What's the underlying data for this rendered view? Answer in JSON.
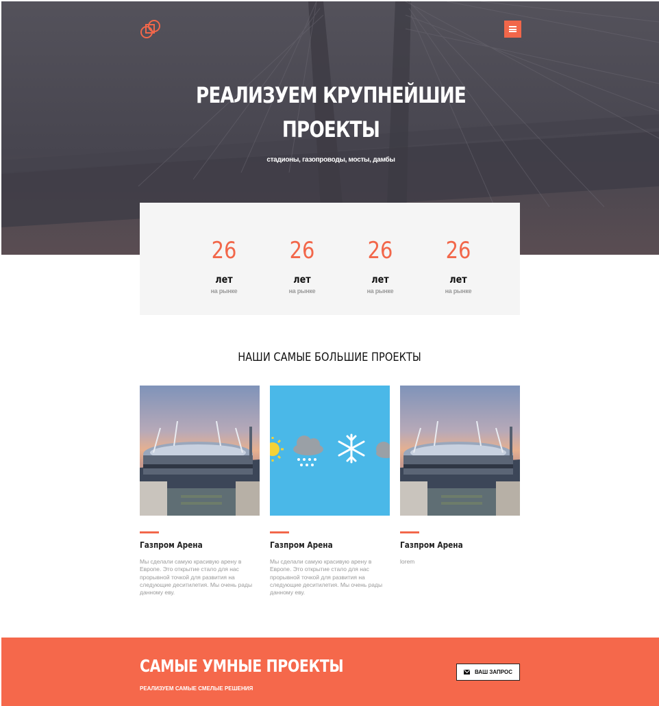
{
  "hero": {
    "title_line1": "РЕАЛИЗУЕМ КРУПНЕЙШИЕ",
    "title_line2": "ПРОЕКТЫ",
    "subtitle": "стадионы, газопроводы, мосты, дамбы",
    "menu_icon": "hamburger-icon",
    "logo_icon": "interlocked-squares-logo"
  },
  "stats": [
    {
      "number": "26",
      "unit": "лет",
      "label": "на рынке"
    },
    {
      "number": "26",
      "unit": "лет",
      "label": "на рынке"
    },
    {
      "number": "26",
      "unit": "лет",
      "label": "на рынке"
    },
    {
      "number": "26",
      "unit": "лет",
      "label": "на рынке"
    }
  ],
  "projects": {
    "title": "НАШИ САМЫЕ БОЛЬШИЕ ПРОЕКТЫ",
    "cards": [
      {
        "title": "Газпром Арена",
        "text": "Мы сделали самую красивую арену в Европе. Это открытие стало для нас прорывной точкой для развития на следующие деситилетия. Мы очень рады данному еву.",
        "image": "stadium-photo"
      },
      {
        "title": "Газпром Арена",
        "text": "Мы сделали самую красивую арену в Европе. Это открытие стало для нас прорывной точкой для развития на следующие деситилетия. Мы очень рады данному еву.",
        "image": "weather-icons-image"
      },
      {
        "title": "Газпром Арена",
        "text": "lorem",
        "image": "stadium-photo"
      }
    ]
  },
  "band": {
    "title": "САМЫЕ УМНЫЕ ПРОЕКТЫ",
    "subtitle": "РЕАЛИЗУЕМ САМЫЕ СМЕЛЫЕ РЕШЕНИЯ",
    "button_label": "ВАШ ЗАПРОС",
    "button_icon": "envelope-icon"
  },
  "colors": {
    "accent": "#f2674a",
    "hero_bg": "#4d4c55",
    "stats_bg": "#f5f5f5",
    "sky_blue": "#4ab8e8"
  }
}
